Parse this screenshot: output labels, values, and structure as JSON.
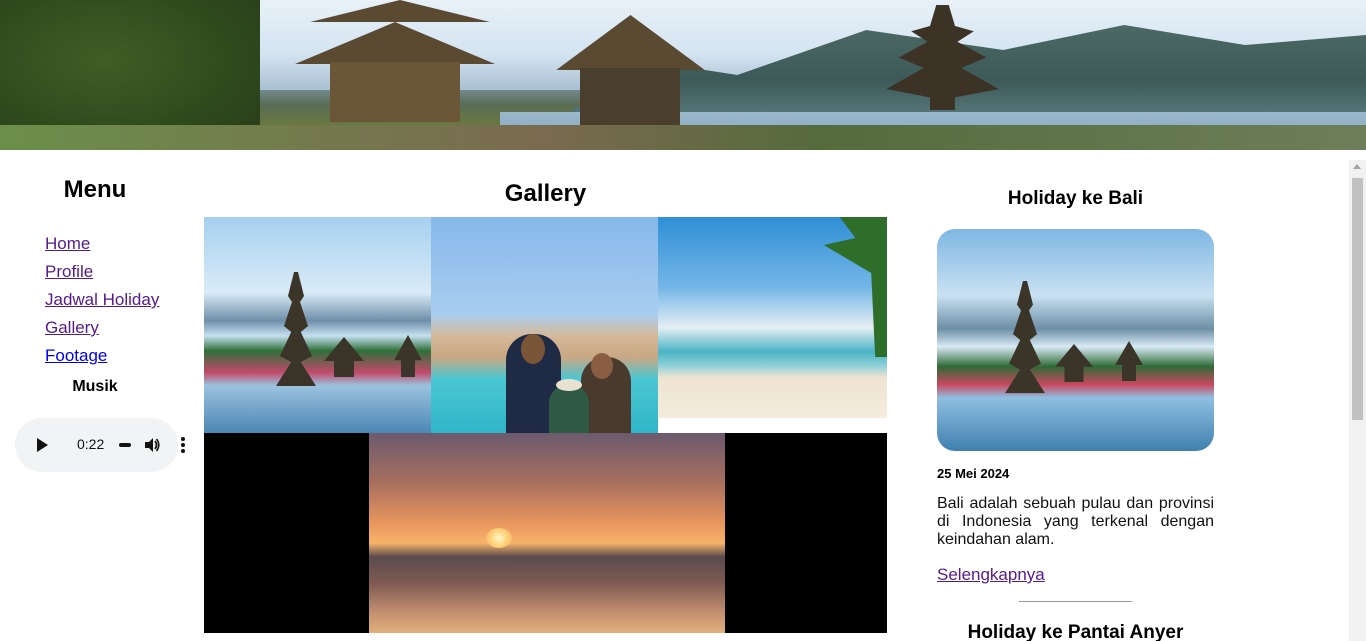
{
  "menu": {
    "title": "Menu",
    "items": [
      {
        "label": "Home"
      },
      {
        "label": "Profile"
      },
      {
        "label": "Jadwal Holiday"
      },
      {
        "label": "Gallery"
      },
      {
        "label": "Footage"
      }
    ],
    "music_label": "Musik",
    "audio": {
      "time": "0:22"
    }
  },
  "gallery": {
    "title": "Gallery"
  },
  "sidebar": {
    "post1": {
      "title": "Holiday ke Bali",
      "date": "25 Mei 2024",
      "description": "Bali adalah sebuah pulau dan provinsi di Indonesia yang terkenal dengan keindahan alam.",
      "read_more": "Selengkapnya"
    },
    "post2": {
      "title": "Holiday ke Pantai Anyer"
    }
  },
  "colors": {
    "link_visited": "#551a8b",
    "link_unvisited": "#0000ee"
  }
}
